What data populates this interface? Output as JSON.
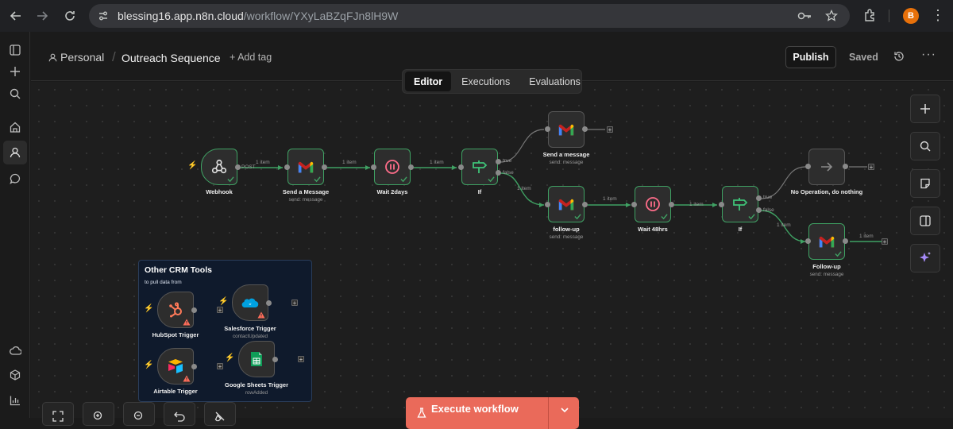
{
  "browser": {
    "url_domain": "blessing16.app.n8n.cloud",
    "url_path": "/workflow/YXyLaBZqFJn8lH9W",
    "profile_initial": "B"
  },
  "header": {
    "project": "Personal",
    "workflow_title": "Outreach Sequence",
    "add_tag": "+ Add tag",
    "publish": "Publish",
    "saved": "Saved"
  },
  "tabs": [
    "Editor",
    "Executions",
    "Evaluations"
  ],
  "active_tab": "Editor",
  "nodes": {
    "webhook": {
      "label": "Webhook"
    },
    "send_a_message_1": {
      "label": "Send a Message",
      "sub": "send: message"
    },
    "wait_2days": {
      "label": "Wait 2days"
    },
    "if_1": {
      "label": "If"
    },
    "send_a_message_2": {
      "label": "Send a message",
      "sub": "send: message"
    },
    "follow_up_1": {
      "label": "follow-up",
      "sub": "send: message"
    },
    "wait_48hrs": {
      "label": "Wait 48hrs"
    },
    "if_2": {
      "label": "If"
    },
    "no_op": {
      "label": "No Operation, do nothing"
    },
    "follow_up_2": {
      "label": "Follow-up",
      "sub": "send: message"
    },
    "hubspot": {
      "label": "HubSpot Trigger"
    },
    "salesforce": {
      "label": "Salesforce Trigger",
      "sub": "contactUpdated"
    },
    "airtable": {
      "label": "Airtable Trigger"
    },
    "gsheets": {
      "label": "Google Sheets Trigger",
      "sub": "rowAdded"
    }
  },
  "edge_labels": {
    "post": "POST",
    "one_item": "1 item",
    "true": "true",
    "false": "false"
  },
  "sticky": {
    "title": "Other CRM Tools",
    "subtitle": "to pull data from"
  },
  "execute": {
    "label": "Execute workflow"
  },
  "colors": {
    "success_green": "#3fa163",
    "accent": "#ea6a5a",
    "canvas": "#1e1e1e"
  }
}
